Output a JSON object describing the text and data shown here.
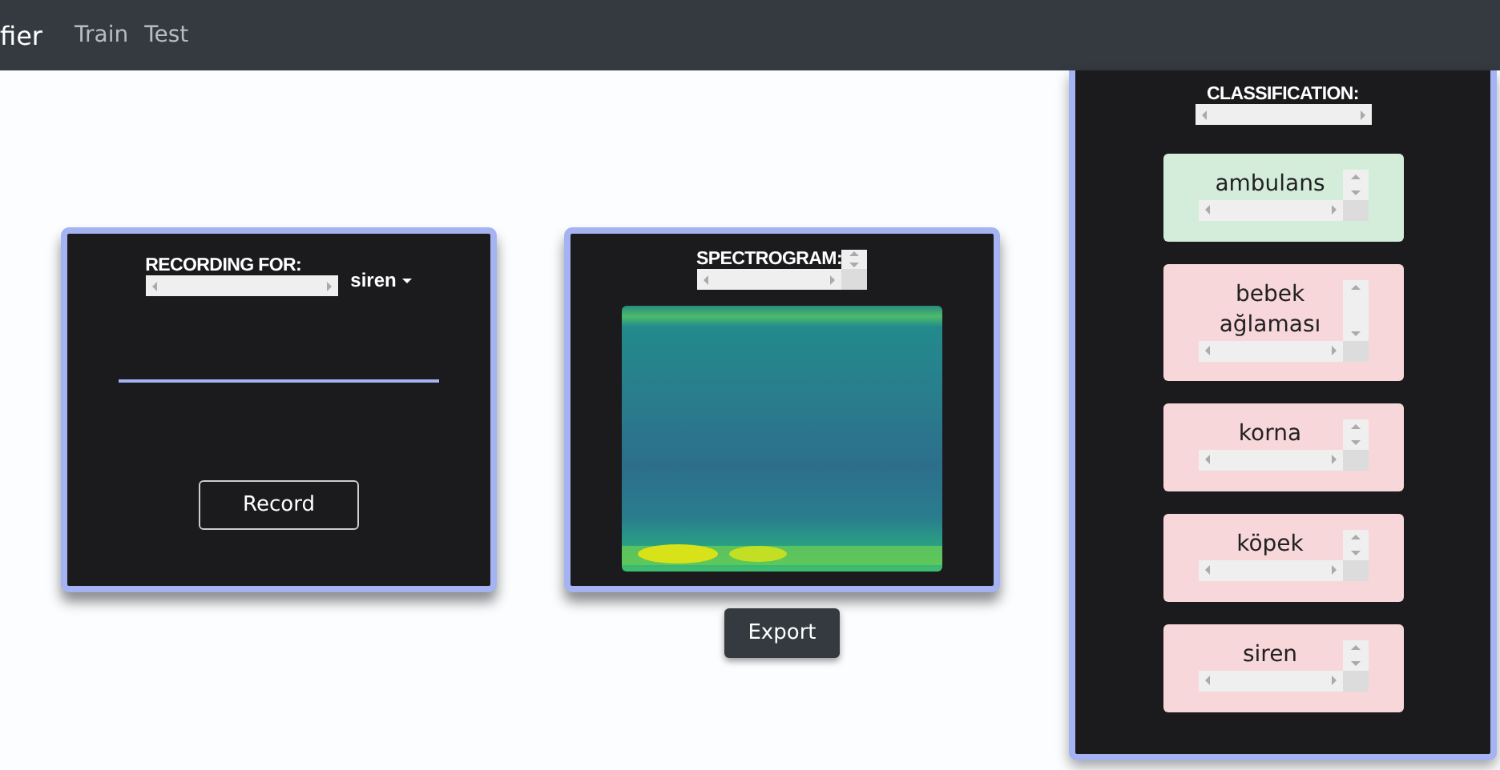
{
  "navbar": {
    "brand": "fier",
    "links": [
      {
        "label": "Train"
      },
      {
        "label": "Test"
      }
    ]
  },
  "recording": {
    "label": "RECORDING FOR:",
    "dropdown": "siren",
    "button": "Record"
  },
  "spectrogram": {
    "label": "SPECTROGRAM:",
    "button": "Export"
  },
  "classification": {
    "label": "CLASSIFICATION:",
    "classes": [
      {
        "label": "ambulans",
        "match": true
      },
      {
        "label": "bebek ağlaması",
        "match": false
      },
      {
        "label": "korna",
        "match": false
      },
      {
        "label": "köpek",
        "match": false
      },
      {
        "label": "siren",
        "match": false
      }
    ]
  }
}
